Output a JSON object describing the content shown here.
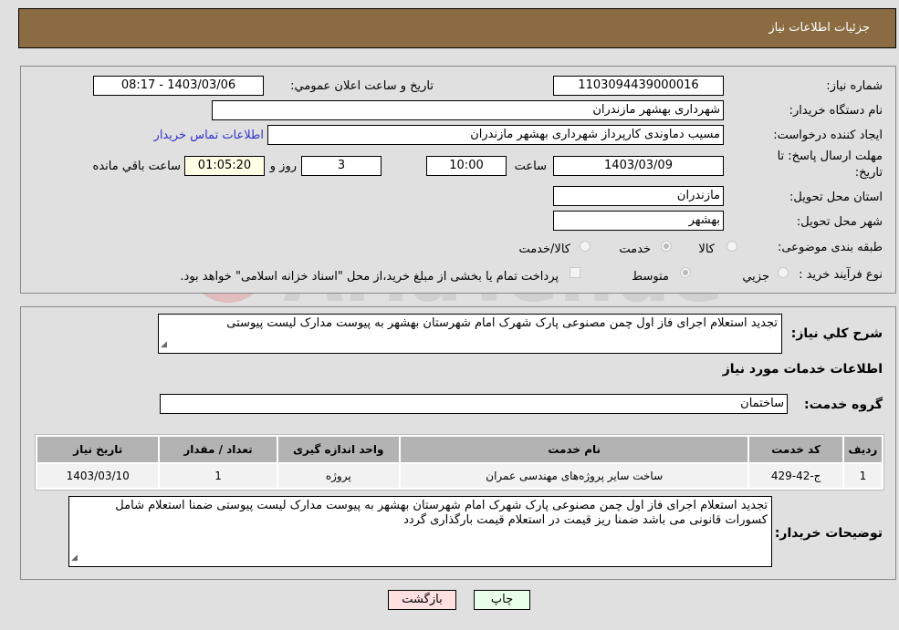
{
  "header": {
    "title": "جزئیات اطلاعات نیاز"
  },
  "details": {
    "need_number_label": "شماره نیاز:",
    "need_number": "1103094439000016",
    "announce_label": "تاریخ و ساعت اعلان عمومي:",
    "announce_value": "1403/03/06 - 08:17",
    "buyer_org_label": "نام دستگاه خریدار:",
    "buyer_org": "شهرداری بهشهر مازندران",
    "creator_label": "ایجاد کننده درخواست:",
    "creator": "مسیب دماوندی کارپرداز شهرداری بهشهر مازندران",
    "contact_link": "اطلاعات تماس خریدار",
    "deadline_label_line1": "مهلت ارسال پاسخ: تا",
    "deadline_label_line2": "تاریخ:",
    "deadline_date": "1403/03/09",
    "time_label": "ساعت",
    "deadline_time": "10:00",
    "days_value": "3",
    "days_label": "روز و",
    "remaining_time": "01:05:20",
    "remaining_label": "ساعت باقي مانده",
    "province_label": "استان محل تحویل:",
    "province": "مازندران",
    "city_label": "شهر محل تحویل:",
    "city": "بهشهر",
    "category_label": "طبقه بندی موضوعی:",
    "category_options": [
      "کالا",
      "خدمت",
      "کالا/خدمت"
    ],
    "category_selected": "خدمت",
    "purchase_type_label": "نوع فرآیند خرید :",
    "purchase_type_options": [
      "جزيي",
      "متوسط"
    ],
    "purchase_type_selected": "متوسط",
    "treasury_note": "پرداخت تمام یا بخشی از مبلغ خرید،از محل \"اسناد خزانه اسلامی\" خواهد بود."
  },
  "services": {
    "description_label": "شرح کلي نیاز:",
    "description": "تجدید استعلام اجرای فاز اول چمن مصنوعی پارک شهرک امام شهرستان بهشهر به پیوست مدارک لیست پیوستی",
    "section_title": "اطلاعات خدمات مورد نیاز",
    "group_label": "گروه خدمت:",
    "group_value": "ساختمان",
    "table": {
      "headers": [
        "ردیف",
        "کد خدمت",
        "نام خدمت",
        "واحد اندازه گیری",
        "تعداد / مقدار",
        "تاریخ نیاز"
      ],
      "rows": [
        [
          "1",
          "ج-42-429",
          "ساخت سایر پروژه‌های مهندسی عمران",
          "پروژه",
          "1",
          "1403/03/10"
        ]
      ]
    },
    "buyer_notes_label": "توضیحات خریدار:",
    "buyer_notes": "تجدید استعلام اجرای فاز اول چمن مصنوعی پارک شهرک امام شهرستان بهشهر به پیوست مدارک لیست پیوستی ضمنا استعلام شامل کسورات قانونی می باشد ضمنا ریز قیمت در استعلام قیمت بارگذاری گردد"
  },
  "buttons": {
    "print": "چاپ",
    "back": "بازگشت"
  },
  "watermark": {
    "text": "AriaTender.neT"
  },
  "colors": {
    "header_bg": "#8b6c42",
    "link": "#3333cc",
    "print_bg": "#eaffea",
    "back_bg": "#ffe0e0",
    "remaining_bg": "#ffffe6"
  }
}
